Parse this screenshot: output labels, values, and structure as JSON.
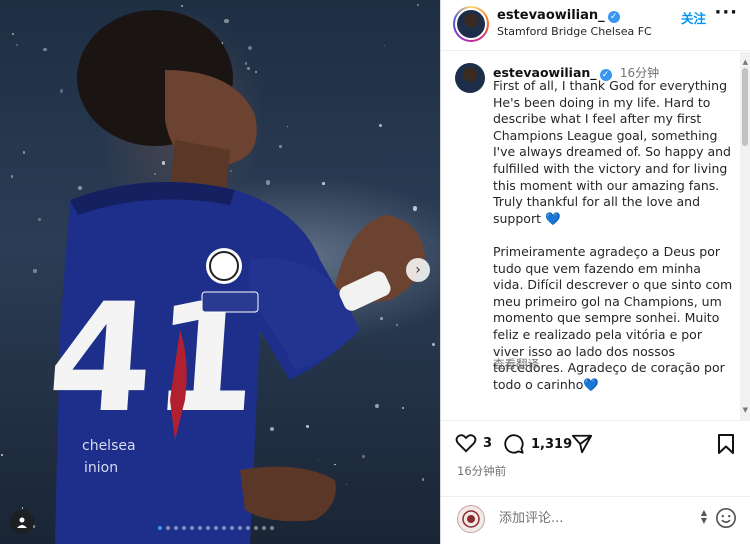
{
  "post": {
    "username": "estevaowilian_",
    "location": "Stamford Bridge Chelsea FC",
    "follow_label": "关注",
    "more_label": "···"
  },
  "caption": {
    "username": "estevaowilian_",
    "time": "16分钟",
    "text_en": "First of all, I thank God for everything He's been doing in my life. Hard to describe what I feel after my first Champions League goal, something I've always dreamed of. So happy and fulfilled with the victory and for living this moment with our amazing fans. Truly thankful for all the love and support",
    "text_pt": "Primeiramente agradeço a Deus por tudo que vem fazendo em minha vida. Difícil descrever o que sinto com meu primeiro gol na Champions, um momento que sempre sonhei. Muito feliz e realizado pela vitória e por viver isso ao lado dos nossos torcedores. Agradeço de coração por todo o carinho",
    "heart_emoji": "💙",
    "translate_label": "查看翻译"
  },
  "actions": {
    "like_count": "3",
    "comment_count": "1,319",
    "posted_time": "16分钟前"
  },
  "composer": {
    "placeholder": "添加评论..."
  },
  "carousel": {
    "dot_count": 15,
    "active_index": 0
  },
  "colors": {
    "accent": "#0095f6",
    "verified": "#3897f0",
    "heart_emoji": "#2d7fe0"
  }
}
